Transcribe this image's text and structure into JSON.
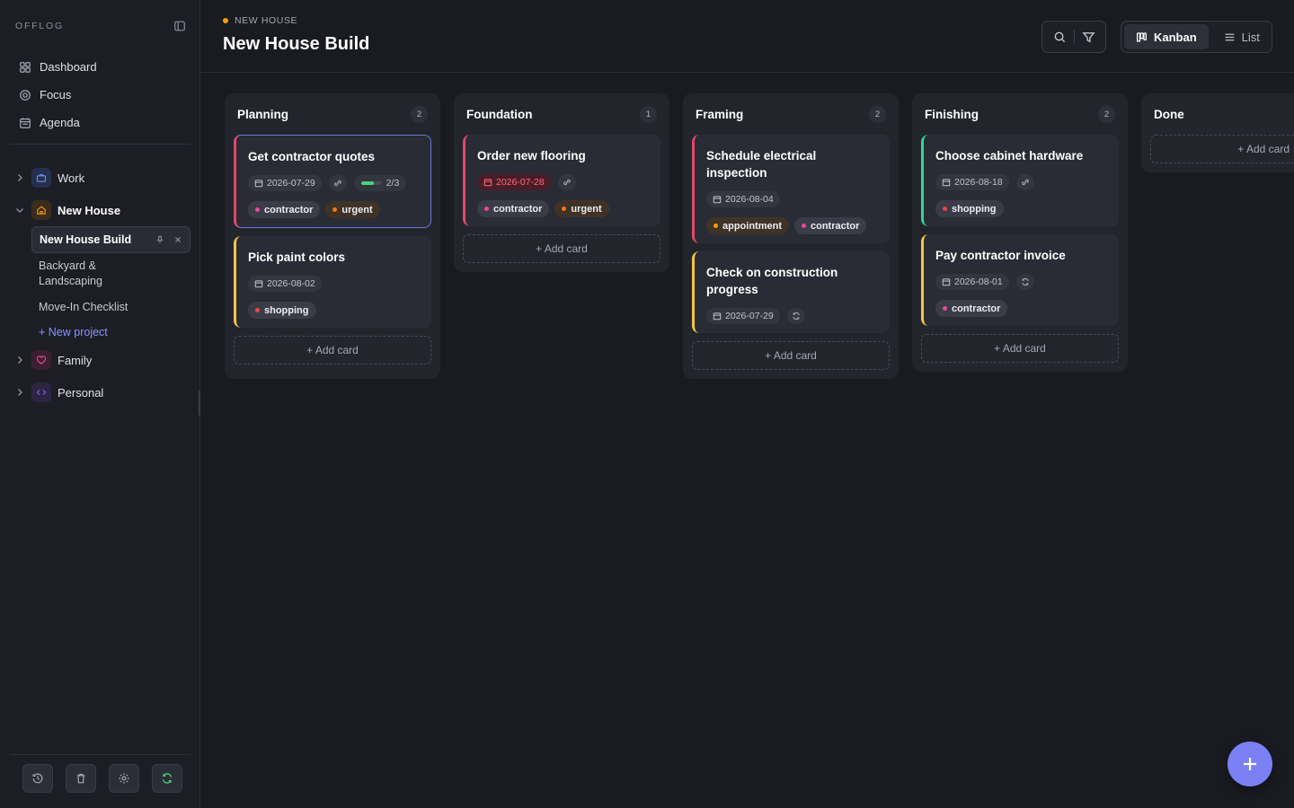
{
  "sidebar": {
    "brand": "OFFLOG",
    "nav": [
      {
        "label": "Dashboard",
        "icon": "dashboard-icon"
      },
      {
        "label": "Focus",
        "icon": "target-icon"
      },
      {
        "label": "Agenda",
        "icon": "calendar-icon"
      }
    ],
    "groups": {
      "work": {
        "label": "Work",
        "icon": "briefcase-icon",
        "color": "#6f8cff"
      },
      "new_house": {
        "label": "New House",
        "icon": "home-icon",
        "color": "#f59e0b"
      },
      "family": {
        "label": "Family",
        "icon": "heart-icon",
        "color": "#ec4899"
      },
      "personal": {
        "label": "Personal",
        "icon": "code-icon",
        "color": "#8b5cf6"
      }
    },
    "projects": [
      "New House Build",
      "Backyard & Landscaping",
      "Move-In Checklist"
    ],
    "new_project": "+ New project"
  },
  "header": {
    "breadcrumb": "NEW HOUSE",
    "title": "New House Build",
    "views": {
      "kanban": "Kanban",
      "list": "List"
    }
  },
  "board": {
    "add_card": "+ Add card",
    "columns": [
      {
        "title": "Planning",
        "count": "2",
        "cards": [
          {
            "title": "Get contractor quotes",
            "date": "2026-07-29",
            "progress": "2/3",
            "progress_fraction": 0.67,
            "tags": [
              {
                "label": "contractor",
                "color": "#ec4899"
              },
              {
                "label": "urgent",
                "color": "#f97316"
              }
            ],
            "accent": "#e0476b"
          },
          {
            "title": "Pick paint colors",
            "date": "2026-08-02",
            "tags": [
              {
                "label": "shopping",
                "color": "#ef4444"
              }
            ],
            "accent": "#f5c542"
          }
        ]
      },
      {
        "title": "Foundation",
        "count": "1",
        "cards": [
          {
            "title": "Order new flooring",
            "date": "2026-07-28",
            "tags": [
              {
                "label": "contractor",
                "color": "#ec4899"
              },
              {
                "label": "urgent",
                "color": "#f97316"
              }
            ],
            "accent": "#e0476b"
          }
        ]
      },
      {
        "title": "Framing",
        "count": "2",
        "cards": [
          {
            "title": "Schedule electrical inspection",
            "date": "2026-08-04",
            "tags": [
              {
                "label": "appointment",
                "color": "#f59e0b"
              },
              {
                "label": "contractor",
                "color": "#ec4899"
              }
            ],
            "accent": "#e0476b"
          },
          {
            "title": "Check on construction progress",
            "date": "2026-07-29",
            "accent": "#f5c542"
          }
        ]
      },
      {
        "title": "Finishing",
        "count": "2",
        "cards": [
          {
            "title": "Choose cabinet hardware",
            "date": "2026-08-18",
            "tags": [
              {
                "label": "shopping",
                "color": "#ef4444"
              }
            ],
            "accent": "#34d399"
          },
          {
            "title": "Pay contractor invoice",
            "date": "2026-08-01",
            "tags": [
              {
                "label": "contractor",
                "color": "#ec4899"
              }
            ],
            "accent": "#f5c542"
          }
        ]
      },
      {
        "title": "Done"
      }
    ]
  }
}
